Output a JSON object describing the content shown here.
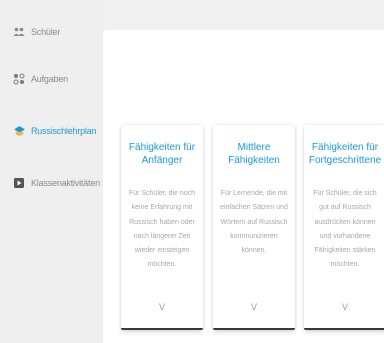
{
  "sidebar": {
    "items": [
      {
        "label": "Schüler",
        "icon": "students-icon"
      },
      {
        "label": "Aufgaben",
        "icon": "tasks-icon"
      },
      {
        "label": "Russischlehrplan",
        "icon": "curriculum-icon",
        "active": true
      },
      {
        "label": "Klassenaktivitäten",
        "icon": "play-icon"
      }
    ]
  },
  "modal": {
    "cards": [
      {
        "title": "Fähigkeiten für Anfänger",
        "description": "Für Schüler, die noch keine Erfahrung mit Russisch haben oder nach längerer Zeit wieder einsteigen möchten.",
        "chevron": "V"
      },
      {
        "title": "Mittlere Fähigkeiten",
        "description": "Für Lernende, die mit einfachen Sätzen und Wörtern auf Russisch kommunizieren können.",
        "chevron": "V"
      },
      {
        "title": "Fähigkeiten für Fortgeschrittene",
        "description": "Für Schüler, die sich gut auf Russisch ausdrücken können und vorhandene Fähigkeiten stärken möchten.",
        "chevron": "V"
      }
    ]
  },
  "colors": {
    "accent": "#1a9ad6",
    "sidebar_bg": "#efefef",
    "muted_text": "#8a8a8a"
  }
}
